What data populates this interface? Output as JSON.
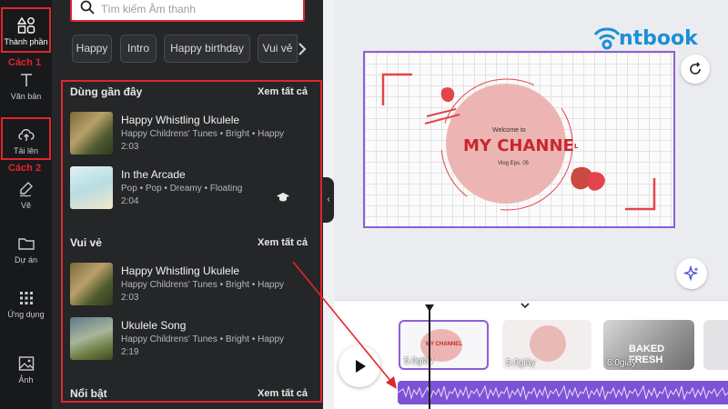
{
  "rail": {
    "items": [
      {
        "label": "Thành phần",
        "icon": "shapes-icon"
      },
      {
        "label": "Văn bản",
        "icon": "text-icon"
      },
      {
        "label": "Tải lên",
        "icon": "cloud-upload-icon"
      },
      {
        "label": "Vẽ",
        "icon": "pen-draw-icon"
      },
      {
        "label": "Dự án",
        "icon": "folder-icon"
      },
      {
        "label": "Ứng dụng",
        "icon": "apps-grid-icon"
      },
      {
        "label": "Ảnh",
        "icon": "image-icon"
      }
    ]
  },
  "annotations": {
    "method1": "Cách 1",
    "method2": "Cách 2"
  },
  "search": {
    "placeholder": "Tìm kiếm Âm thanh"
  },
  "chips": [
    "Happy",
    "Intro",
    "Happy birthday",
    "Vui vẻ"
  ],
  "sections": [
    {
      "title": "Dùng gần đây",
      "see_all": "Xem tất cả",
      "tracks": [
        {
          "title": "Happy Whistling Ukulele",
          "meta": "Happy Childrens' Tunes • Bright • Happy",
          "duration": "2:03"
        },
        {
          "title": "In the Arcade",
          "meta": "Pop • Pop • Dreamy • Floating",
          "duration": "2:04"
        }
      ]
    },
    {
      "title": "Vui vẻ",
      "see_all": "Xem tất cả",
      "tracks": [
        {
          "title": "Happy Whistling Ukulele",
          "meta": "Happy Childrens' Tunes • Bright • Happy",
          "duration": "2:03"
        },
        {
          "title": "Ukulele Song",
          "meta": "Happy Childrens' Tunes • Bright • Happy",
          "duration": "2:19"
        }
      ]
    },
    {
      "title": "Nổi bật",
      "see_all": "Xem tất cả",
      "tracks": []
    }
  ],
  "slide": {
    "welcome": "Welcome to",
    "channel": "MY CHANNE",
    "channel_tail": "L",
    "vlog": "Vlog Eps. 05"
  },
  "brand": {
    "logo": "ntbook",
    "color": "#1c8fd7"
  },
  "timeline": {
    "clips": [
      {
        "label": "5.0giây",
        "mini_text": "MY CHANNEL"
      },
      {
        "label": "5.0giây"
      },
      {
        "label": "6.0giây",
        "overlay": "BAKED FRESH"
      }
    ]
  },
  "colors": {
    "accent": "#8b5fd6",
    "annotation": "#e0262d",
    "panel": "#252627"
  }
}
